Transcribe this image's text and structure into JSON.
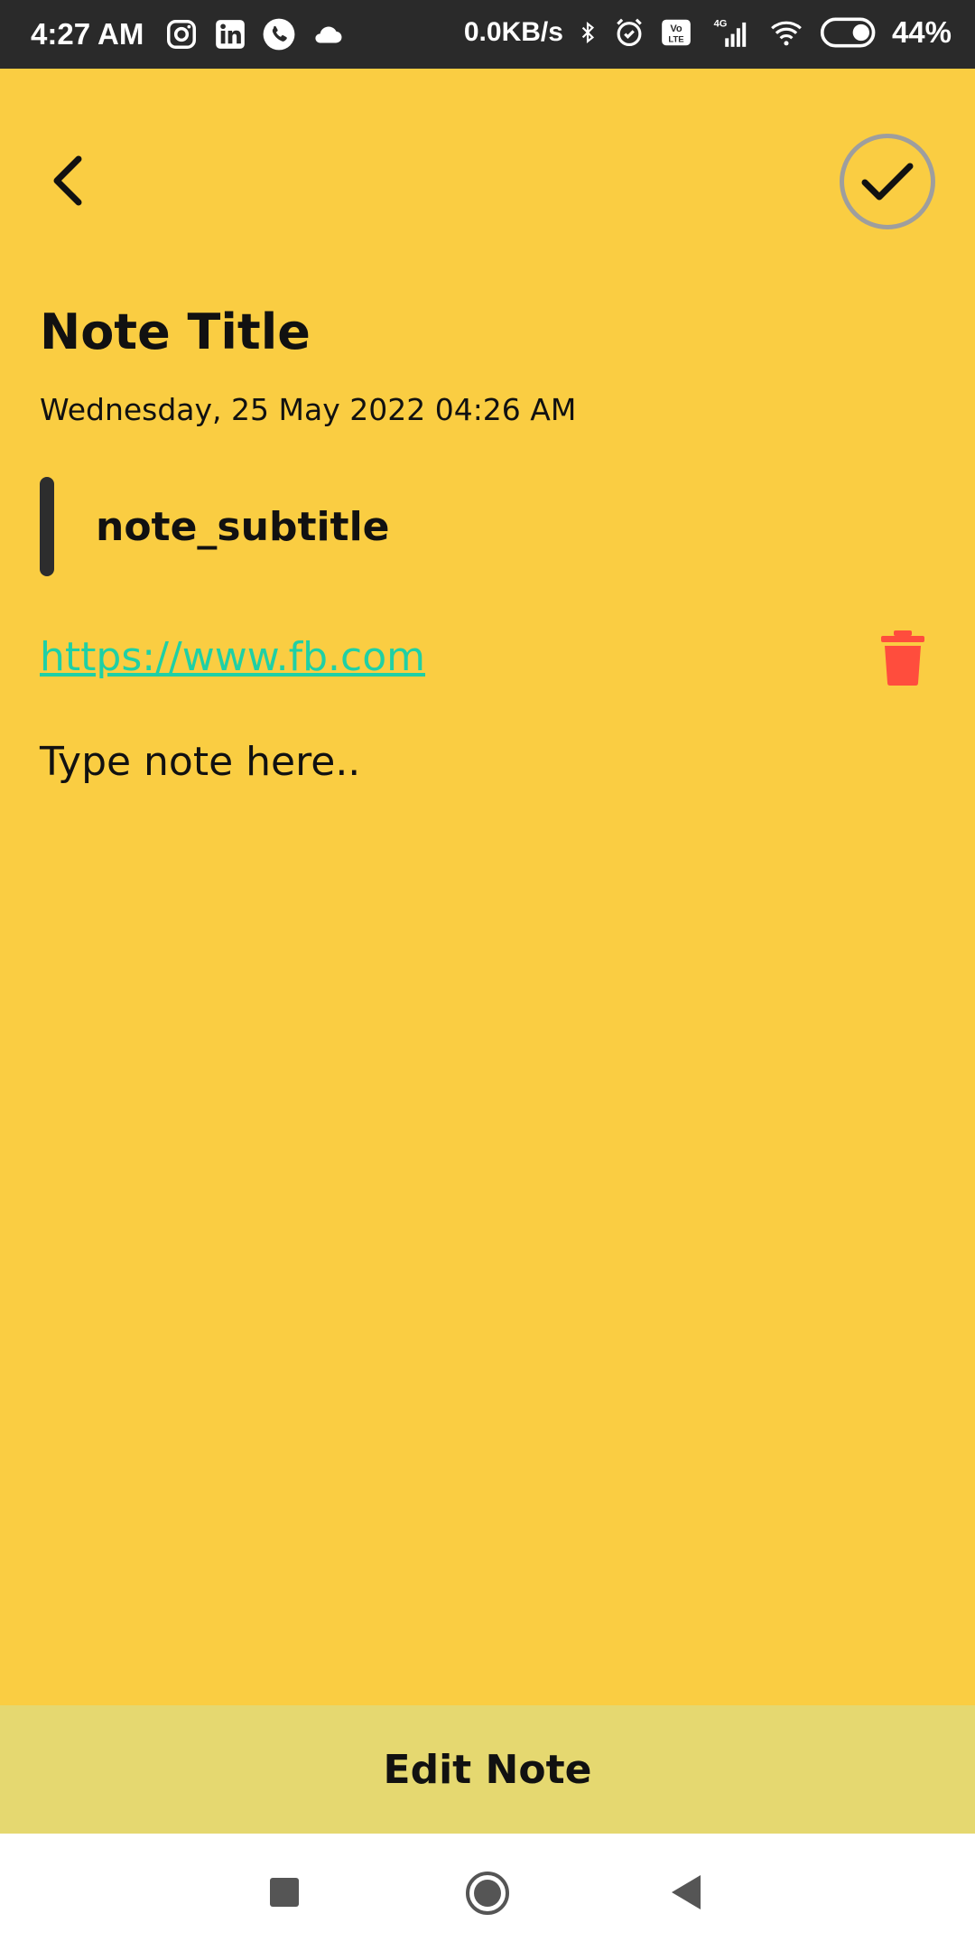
{
  "status_bar": {
    "time": "4:27 AM",
    "network_speed": "0.0KB/s",
    "battery_percent": "44%",
    "icons_left": [
      "instagram-icon",
      "linkedin-icon",
      "phone-icon",
      "cloud-icon"
    ],
    "icons_right": [
      "bluetooth-icon",
      "alarm-icon",
      "volte-icon",
      "signal-icon",
      "wifi-icon",
      "battery-icon"
    ],
    "network_type": "4G",
    "volte_label_top": "Vo",
    "volte_label_bottom": "LTE"
  },
  "toolbar": {
    "back_icon": "chevron-left-icon",
    "save_icon": "check-icon"
  },
  "note": {
    "title": "Note Title",
    "date": "Wednesday, 25 May 2022 04:26 AM",
    "subtitle": "note_subtitle",
    "url": "https://www.fb.com",
    "body_placeholder": "Type note here.."
  },
  "bottom": {
    "edit_label": "Edit Note"
  },
  "colors": {
    "background": "#FACD42",
    "edit_bar": "#E5D870",
    "url": "#1FD0A5",
    "delete": "#FF4D3D",
    "status_bar": "#2a2a2a"
  },
  "nav": {
    "icons": [
      "recents-square-icon",
      "home-circle-icon",
      "back-triangle-icon"
    ]
  }
}
